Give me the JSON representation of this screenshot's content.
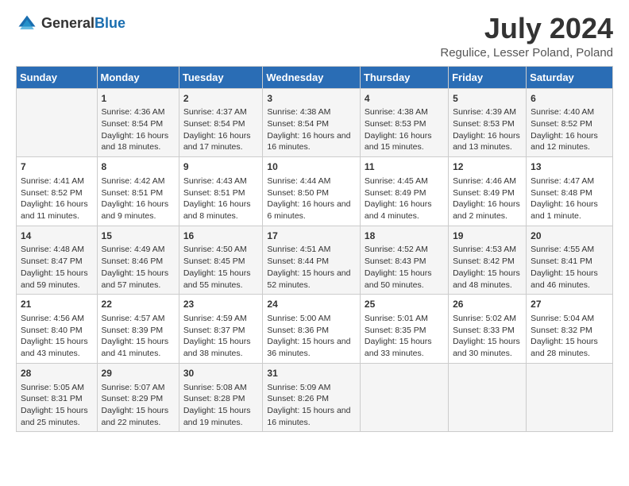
{
  "header": {
    "logo_general": "General",
    "logo_blue": "Blue",
    "title": "July 2024",
    "subtitle": "Regulice, Lesser Poland, Poland"
  },
  "columns": [
    "Sunday",
    "Monday",
    "Tuesday",
    "Wednesday",
    "Thursday",
    "Friday",
    "Saturday"
  ],
  "rows": [
    [
      {
        "day": "",
        "content": ""
      },
      {
        "day": "1",
        "content": "Sunrise: 4:36 AM\nSunset: 8:54 PM\nDaylight: 16 hours\nand 18 minutes."
      },
      {
        "day": "2",
        "content": "Sunrise: 4:37 AM\nSunset: 8:54 PM\nDaylight: 16 hours\nand 17 minutes."
      },
      {
        "day": "3",
        "content": "Sunrise: 4:38 AM\nSunset: 8:54 PM\nDaylight: 16 hours\nand 16 minutes."
      },
      {
        "day": "4",
        "content": "Sunrise: 4:38 AM\nSunset: 8:53 PM\nDaylight: 16 hours\nand 15 minutes."
      },
      {
        "day": "5",
        "content": "Sunrise: 4:39 AM\nSunset: 8:53 PM\nDaylight: 16 hours\nand 13 minutes."
      },
      {
        "day": "6",
        "content": "Sunrise: 4:40 AM\nSunset: 8:52 PM\nDaylight: 16 hours\nand 12 minutes."
      }
    ],
    [
      {
        "day": "7",
        "content": "Sunrise: 4:41 AM\nSunset: 8:52 PM\nDaylight: 16 hours\nand 11 minutes."
      },
      {
        "day": "8",
        "content": "Sunrise: 4:42 AM\nSunset: 8:51 PM\nDaylight: 16 hours\nand 9 minutes."
      },
      {
        "day": "9",
        "content": "Sunrise: 4:43 AM\nSunset: 8:51 PM\nDaylight: 16 hours\nand 8 minutes."
      },
      {
        "day": "10",
        "content": "Sunrise: 4:44 AM\nSunset: 8:50 PM\nDaylight: 16 hours\nand 6 minutes."
      },
      {
        "day": "11",
        "content": "Sunrise: 4:45 AM\nSunset: 8:49 PM\nDaylight: 16 hours\nand 4 minutes."
      },
      {
        "day": "12",
        "content": "Sunrise: 4:46 AM\nSunset: 8:49 PM\nDaylight: 16 hours\nand 2 minutes."
      },
      {
        "day": "13",
        "content": "Sunrise: 4:47 AM\nSunset: 8:48 PM\nDaylight: 16 hours\nand 1 minute."
      }
    ],
    [
      {
        "day": "14",
        "content": "Sunrise: 4:48 AM\nSunset: 8:47 PM\nDaylight: 15 hours\nand 59 minutes."
      },
      {
        "day": "15",
        "content": "Sunrise: 4:49 AM\nSunset: 8:46 PM\nDaylight: 15 hours\nand 57 minutes."
      },
      {
        "day": "16",
        "content": "Sunrise: 4:50 AM\nSunset: 8:45 PM\nDaylight: 15 hours\nand 55 minutes."
      },
      {
        "day": "17",
        "content": "Sunrise: 4:51 AM\nSunset: 8:44 PM\nDaylight: 15 hours\nand 52 minutes."
      },
      {
        "day": "18",
        "content": "Sunrise: 4:52 AM\nSunset: 8:43 PM\nDaylight: 15 hours\nand 50 minutes."
      },
      {
        "day": "19",
        "content": "Sunrise: 4:53 AM\nSunset: 8:42 PM\nDaylight: 15 hours\nand 48 minutes."
      },
      {
        "day": "20",
        "content": "Sunrise: 4:55 AM\nSunset: 8:41 PM\nDaylight: 15 hours\nand 46 minutes."
      }
    ],
    [
      {
        "day": "21",
        "content": "Sunrise: 4:56 AM\nSunset: 8:40 PM\nDaylight: 15 hours\nand 43 minutes."
      },
      {
        "day": "22",
        "content": "Sunrise: 4:57 AM\nSunset: 8:39 PM\nDaylight: 15 hours\nand 41 minutes."
      },
      {
        "day": "23",
        "content": "Sunrise: 4:59 AM\nSunset: 8:37 PM\nDaylight: 15 hours\nand 38 minutes."
      },
      {
        "day": "24",
        "content": "Sunrise: 5:00 AM\nSunset: 8:36 PM\nDaylight: 15 hours\nand 36 minutes."
      },
      {
        "day": "25",
        "content": "Sunrise: 5:01 AM\nSunset: 8:35 PM\nDaylight: 15 hours\nand 33 minutes."
      },
      {
        "day": "26",
        "content": "Sunrise: 5:02 AM\nSunset: 8:33 PM\nDaylight: 15 hours\nand 30 minutes."
      },
      {
        "day": "27",
        "content": "Sunrise: 5:04 AM\nSunset: 8:32 PM\nDaylight: 15 hours\nand 28 minutes."
      }
    ],
    [
      {
        "day": "28",
        "content": "Sunrise: 5:05 AM\nSunset: 8:31 PM\nDaylight: 15 hours\nand 25 minutes."
      },
      {
        "day": "29",
        "content": "Sunrise: 5:07 AM\nSunset: 8:29 PM\nDaylight: 15 hours\nand 22 minutes."
      },
      {
        "day": "30",
        "content": "Sunrise: 5:08 AM\nSunset: 8:28 PM\nDaylight: 15 hours\nand 19 minutes."
      },
      {
        "day": "31",
        "content": "Sunrise: 5:09 AM\nSunset: 8:26 PM\nDaylight: 15 hours\nand 16 minutes."
      },
      {
        "day": "",
        "content": ""
      },
      {
        "day": "",
        "content": ""
      },
      {
        "day": "",
        "content": ""
      }
    ]
  ]
}
